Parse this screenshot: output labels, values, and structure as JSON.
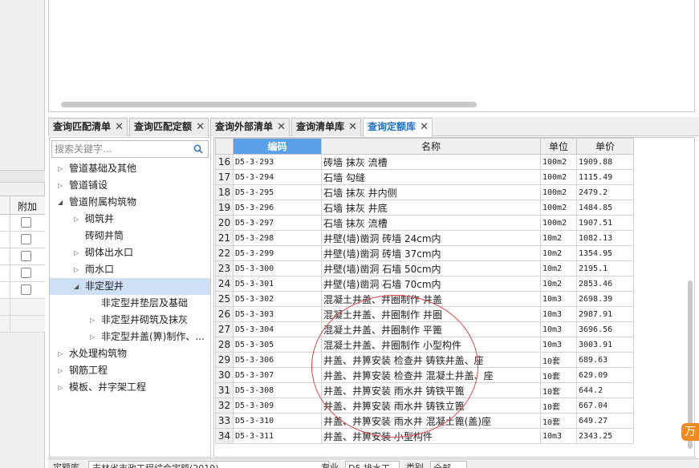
{
  "left_panel": {
    "column_header": "附加",
    "checkbox_rows": 5
  },
  "tabs": [
    {
      "label": "查询匹配清单",
      "active": false
    },
    {
      "label": "查询匹配定额",
      "active": false
    },
    {
      "label": "查询外部清单",
      "active": false
    },
    {
      "label": "查询清单库",
      "active": false
    },
    {
      "label": "查询定额库",
      "active": true
    }
  ],
  "tab_close_glyph": "✕",
  "search": {
    "placeholder": "搜索关键字..."
  },
  "tree": [
    {
      "label": "管道基础及其他",
      "level": 0,
      "arrow": "▷"
    },
    {
      "label": "管道铺设",
      "level": 0,
      "arrow": "▷"
    },
    {
      "label": "管道附属构筑物",
      "level": 0,
      "arrow": "◢"
    },
    {
      "label": "砌筑井",
      "level": 1,
      "arrow": "▷"
    },
    {
      "label": "砖砌井筒",
      "level": 1,
      "arrow": ""
    },
    {
      "label": "砌体出水口",
      "level": 1,
      "arrow": "▷"
    },
    {
      "label": "雨水口",
      "level": 1,
      "arrow": "▷"
    },
    {
      "label": "非定型井",
      "level": 1,
      "arrow": "◢",
      "selected": true
    },
    {
      "label": "非定型井垫层及基础",
      "level": 2,
      "arrow": ""
    },
    {
      "label": "非定型井砌筑及抹灰",
      "level": 2,
      "arrow": "▷"
    },
    {
      "label": "非定型井盖(箅)制作、...",
      "level": 2,
      "arrow": "▷"
    },
    {
      "label": "水处理构筑物",
      "level": 0,
      "arrow": "▷"
    },
    {
      "label": "钢筋工程",
      "level": 0,
      "arrow": "▷"
    },
    {
      "label": "模板、井字架工程",
      "level": 0,
      "arrow": "▷"
    }
  ],
  "grid": {
    "headers": {
      "code": "编码",
      "name": "名称",
      "unit": "单位",
      "price": "单价"
    },
    "rows": [
      {
        "n": "16",
        "code": "D5-3-293",
        "name": "砖墙 抹灰 流槽",
        "unit": "100m2",
        "price": "1909.88"
      },
      {
        "n": "17",
        "code": "D5-3-294",
        "name": "石墙 勾缝",
        "unit": "100m2",
        "price": "1115.49"
      },
      {
        "n": "18",
        "code": "D5-3-295",
        "name": "石墙 抹灰 井内侧",
        "unit": "100m2",
        "price": "2479.2"
      },
      {
        "n": "19",
        "code": "D5-3-296",
        "name": "石墙 抹灰 井底",
        "unit": "100m2",
        "price": "1484.85"
      },
      {
        "n": "20",
        "code": "D5-3-297",
        "name": "石墙 抹灰 流槽",
        "unit": "100m2",
        "price": "1907.51"
      },
      {
        "n": "21",
        "code": "D5-3-298",
        "name": "井壁(墙)凿洞 砖墙 24cm内",
        "unit": "10m2",
        "price": "1082.13"
      },
      {
        "n": "22",
        "code": "D5-3-299",
        "name": "井壁(墙)凿洞 砖墙 37cm内",
        "unit": "10m2",
        "price": "1354.95"
      },
      {
        "n": "23",
        "code": "D5-3-300",
        "name": "井壁(墙)凿洞 石墙 50cm内",
        "unit": "10m2",
        "price": "2195.1"
      },
      {
        "n": "24",
        "code": "D5-3-301",
        "name": "井壁(墙)凿洞 石墙 70cm内",
        "unit": "10m2",
        "price": "2853.46"
      },
      {
        "n": "25",
        "code": "D5-3-302",
        "name": "混凝土井盖、井圈制作 井盖",
        "unit": "10m3",
        "price": "2698.39"
      },
      {
        "n": "26",
        "code": "D5-3-303",
        "name": "混凝土井盖、井圈制作 井圈",
        "unit": "10m3",
        "price": "2987.91"
      },
      {
        "n": "27",
        "code": "D5-3-304",
        "name": "混凝土井盖、井圈制作 平篦",
        "unit": "10m3",
        "price": "3696.56"
      },
      {
        "n": "28",
        "code": "D5-3-305",
        "name": "混凝土井盖、井圈制作 小型构件",
        "unit": "10m3",
        "price": "3003.91"
      },
      {
        "n": "29",
        "code": "D5-3-306",
        "name": "井盖、井箅安装 检查井 铸铁井盖、座",
        "unit": "10套",
        "price": "689.63"
      },
      {
        "n": "30",
        "code": "D5-3-307",
        "name": "井盖、井箅安装 检查井 混凝土井盖、座",
        "unit": "10套",
        "price": "629.09"
      },
      {
        "n": "31",
        "code": "D5-3-308",
        "name": "井盖、井箅安装 雨水井 铸铁平篦",
        "unit": "10套",
        "price": "644.2"
      },
      {
        "n": "32",
        "code": "D5-3-309",
        "name": "井盖、井箅安装 雨水井 铸铁立篦",
        "unit": "10套",
        "price": "667.04"
      },
      {
        "n": "33",
        "code": "D5-3-310",
        "name": "井盖、井箅安装 雨水井 混凝土篦(盖)座",
        "unit": "10套",
        "price": "649.27"
      },
      {
        "n": "34",
        "code": "D5-3-311",
        "name": "井盖、井箅安装 小型构件",
        "unit": "10m3",
        "price": "2343.25"
      }
    ]
  },
  "bottom": {
    "label1": "定额库",
    "value1": "吉林省市政工程综合定额(2019)",
    "label2": "专业",
    "value2": "D5 排水工",
    "label3": "类别",
    "value3": "全部"
  },
  "side_button": {
    "glyph": "万"
  },
  "colors": {
    "accent": "#1f6fc5",
    "header_blue": "#5aa0e6",
    "selection": "#cfe0f5",
    "annotation": "#e04848",
    "side_button": "#f08a1f"
  }
}
